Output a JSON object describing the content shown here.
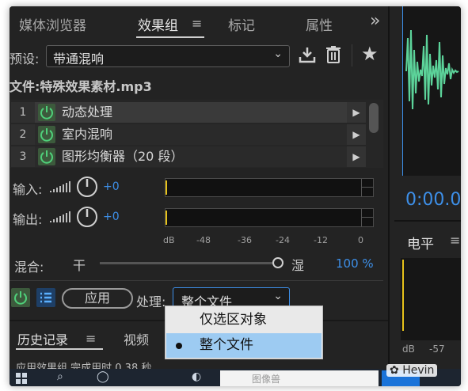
{
  "tabs": {
    "media_browser": "媒体浏览器",
    "effects_rack": "效果组",
    "markers": "标记",
    "properties": "属性",
    "menu_icon": "≡",
    "overflow_icon": "»"
  },
  "preset": {
    "label": "预设:",
    "value": "带通混响"
  },
  "file": {
    "label": "文件:",
    "name": "特殊效果素材.mp3"
  },
  "rack": [
    {
      "num": "1",
      "name": "动态处理"
    },
    {
      "num": "2",
      "name": "室内混响"
    },
    {
      "num": "3",
      "name": "图形均衡器（20 段）"
    }
  ],
  "levels": {
    "input_label": "输入:",
    "output_label": "输出:",
    "input_gain": "+0",
    "output_gain": "+0",
    "scale": [
      "dB",
      "-48",
      "-36",
      "-24",
      "-12",
      "0"
    ]
  },
  "mix": {
    "label": "混合:",
    "dry": "干",
    "wet": "湿",
    "percent": "100 %",
    "level": 1.0
  },
  "controls": {
    "apply": "应用",
    "process_label": "处理:",
    "process_value": "整个文件"
  },
  "dropdown_options": [
    {
      "label": "仅选区对象",
      "selected": false
    },
    {
      "label": "整个文件",
      "selected": true
    }
  ],
  "history": {
    "tab_history": "历史记录",
    "tab_video": "视频",
    "status": "应用效果组 完成用时 0.38 秒"
  },
  "right_panel": {
    "time": "0:00.0",
    "level_title": "电平",
    "scale": [
      "dB",
      "-57"
    ]
  },
  "taskbar": {
    "search_placeholder": "图像兽",
    "watermark": "Hevin"
  },
  "colors": {
    "accent_blue": "#3d8fe8",
    "power_green": "#4fd07a",
    "waveform": "#5cd39a",
    "meter_marker": "#e6c21a"
  }
}
